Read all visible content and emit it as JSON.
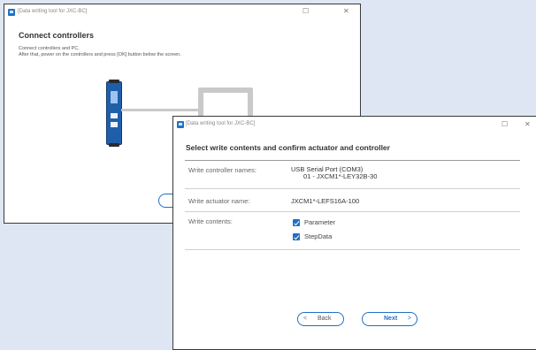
{
  "back_window": {
    "title": "[Data writing tool for JXC-BC]",
    "minimize_glyph": "☐",
    "close_glyph": "✕",
    "heading": "Connect controllers",
    "instruction_line1": "Connect controllers and PC.",
    "instruction_line2": "After that, power on the controllers and press [OK] button below the screen."
  },
  "front_window": {
    "title": "[Data writing tool for JXC-BC]",
    "minimize_glyph": "☐",
    "close_glyph": "✕",
    "heading": "Select write contents and confirm actuator and controller",
    "rows": {
      "controller_label": "Write controller names:",
      "controller_port": "USB Serial Port (COM3)",
      "controller_name": "01 - JXCM1*-LEY32B-30",
      "actuator_label": "Write actuator name:",
      "actuator_value": "JXCM1*-LEFS16A-100",
      "contents_label": "Write contents:",
      "contents": [
        "Parameter",
        "StepData"
      ]
    },
    "back_button": {
      "arrow": "<",
      "label": "Back"
    },
    "next_button": {
      "arrow": ">",
      "label": "Next"
    }
  },
  "colors": {
    "accent": "#1f6fc4",
    "background": "#dfe6f3"
  }
}
